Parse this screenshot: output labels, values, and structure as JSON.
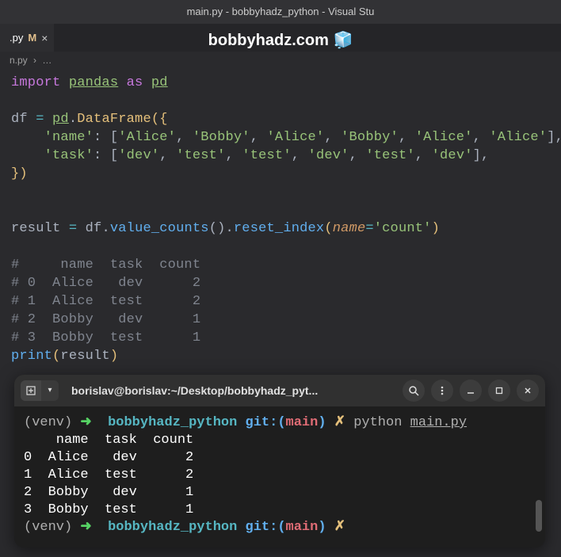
{
  "titleBar": "main.py - bobbyhadz_python - Visual Stu",
  "tab": {
    "name": ".py",
    "modified": "M",
    "close": "×"
  },
  "watermark": {
    "text": "bobbyhadz.com",
    "icon": "🧊"
  },
  "breadcrumb": {
    "file": "n.py",
    "sep": "›",
    "more": "…"
  },
  "code": {
    "l1": {
      "import": "import",
      "pandas": "pandas",
      "as": "as",
      "pd": "pd"
    },
    "l3": {
      "df": "df",
      "eq": "=",
      "pd": "pd",
      "dot": ".",
      "DataFrame": "DataFrame",
      "open": "({"
    },
    "l4": {
      "indent": "    ",
      "key": "'name'",
      "colon": ": [",
      "v1": "'Alice'",
      "c": ", ",
      "v2": "'Bobby'",
      "v3": "'Alice'",
      "v4": "'Bobby'",
      "v5": "'Alice'",
      "v6": "'Alice'",
      "end": "],"
    },
    "l5": {
      "indent": "    ",
      "key": "'task'",
      "colon": ": [",
      "v1": "'dev'",
      "c": ", ",
      "v2": "'test'",
      "v3": "'test'",
      "v4": "'dev'",
      "v5": "'test'",
      "v6": "'dev'",
      "end": "],"
    },
    "l6": {
      "close": "})"
    },
    "l9": {
      "result": "result",
      "eq": "=",
      "df": "df",
      "dot": ".",
      "vc": "value_counts",
      "p1": "().",
      "ri": "reset_index",
      "p2": "(",
      "name": "name",
      "eq2": "=",
      "count": "'count'",
      "p3": ")"
    },
    "l11": "#     name  task  count",
    "l12": "# 0  Alice   dev      2",
    "l13": "# 1  Alice  test      2",
    "l14": "# 2  Bobby   dev      1",
    "l15": "# 3  Bobby  test      1",
    "l16": {
      "print": "print",
      "open": "(",
      "result": "result",
      "close": ")"
    }
  },
  "terminal": {
    "title": "borislav@borislav:~/Desktop/bobbyhadz_pyt...",
    "prompt": {
      "venv": "(venv)",
      "arrow": "➜",
      "dir": "bobbyhadz_python",
      "git": "git:(",
      "branch": "main",
      "gitclose": ")",
      "dirty": "✗",
      "cmd": "python",
      "file": "main.py"
    },
    "output": {
      "header": "    name  task  count",
      "r0": "0  Alice   dev      2",
      "r1": "1  Alice  test      2",
      "r2": "2  Bobby   dev      1",
      "r3": "3  Bobby  test      1"
    }
  },
  "chart_data": {
    "type": "table",
    "columns": [
      "",
      "name",
      "task",
      "count"
    ],
    "rows": [
      [
        0,
        "Alice",
        "dev",
        2
      ],
      [
        1,
        "Alice",
        "test",
        2
      ],
      [
        2,
        "Bobby",
        "dev",
        1
      ],
      [
        3,
        "Bobby",
        "test",
        1
      ]
    ]
  }
}
